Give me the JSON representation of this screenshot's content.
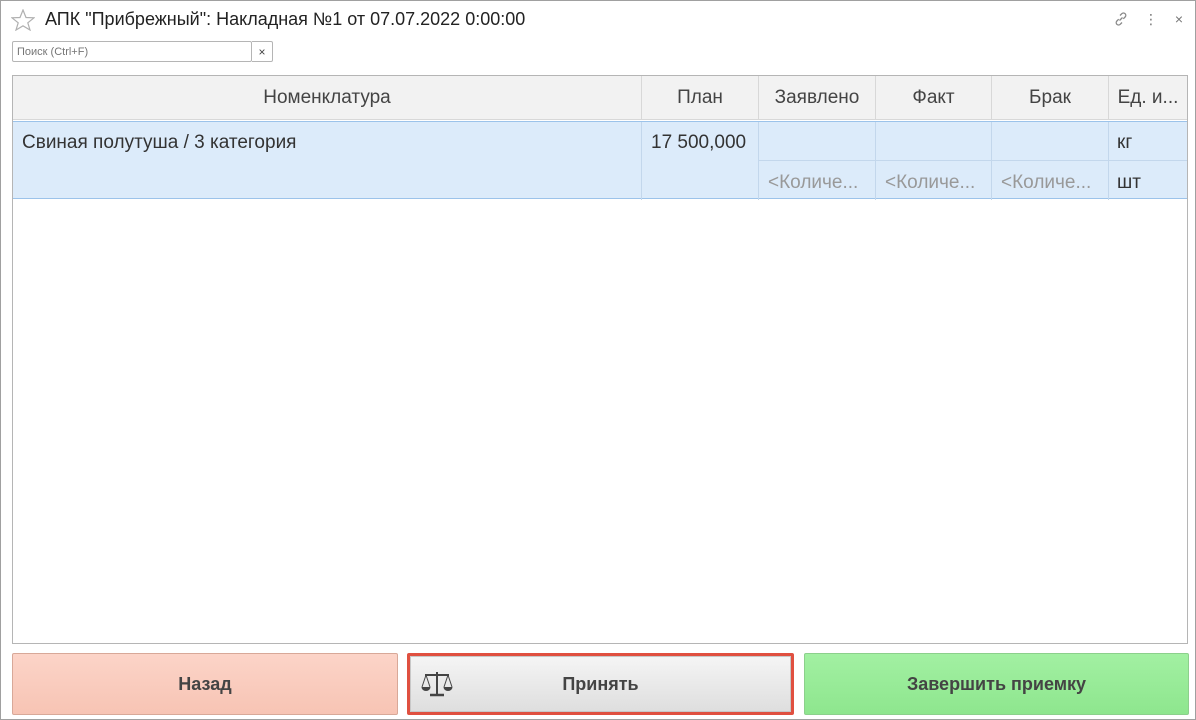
{
  "window": {
    "title": "АПК \"Прибрежный\": Накладная №1 от 07.07.2022 0:00:00",
    "icons": [
      "star-icon",
      "link-icon",
      "more-icon",
      "close-icon"
    ],
    "close_glyph": "×",
    "more_glyph": "⋮"
  },
  "search": {
    "placeholder": "Поиск (Ctrl+F)",
    "clear_label": "×"
  },
  "table": {
    "columns": [
      "Номенклатура",
      "План",
      "Заявлено",
      "Факт",
      "Брак",
      "Ед. и..."
    ],
    "rows": [
      {
        "name": "Свиная полутуша / 3 категория",
        "plan": "17 500,000",
        "declared": "",
        "fact": "",
        "defect": "",
        "unit": "кг",
        "sub": {
          "declared": "<Количе...",
          "fact": "<Количе...",
          "defect": "<Количе...",
          "unit": "шт"
        }
      }
    ]
  },
  "buttons": {
    "back": "Назад",
    "accept": "Принять",
    "finish": "Завершить приемку"
  },
  "colors": {
    "back_bg": "#f9cbbd",
    "accept_border": "#e05040",
    "finish_bg": "#98ec98",
    "row_selected": "#dcebfa"
  }
}
